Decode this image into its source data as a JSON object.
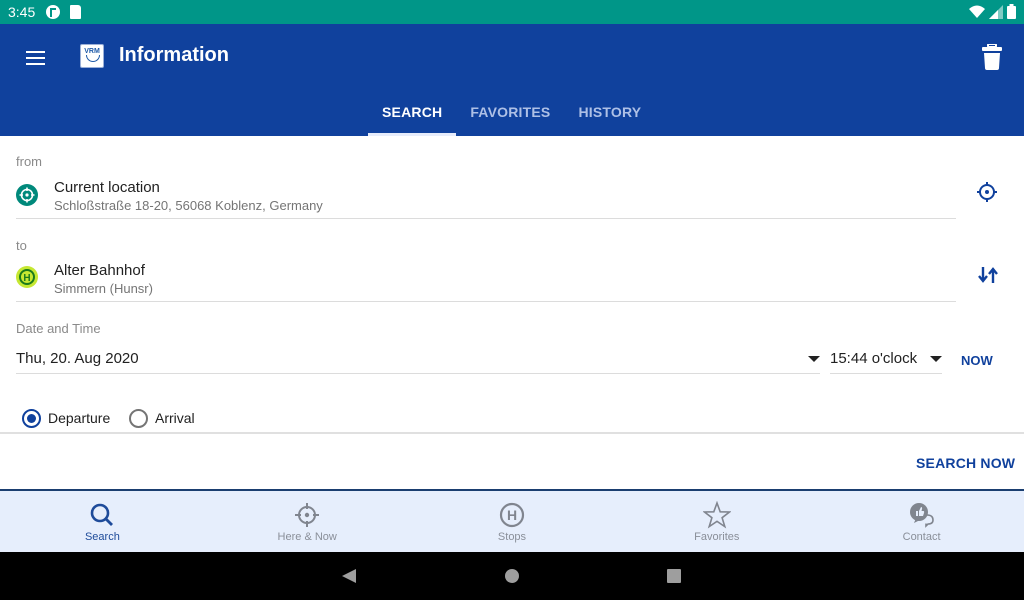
{
  "status_bar": {
    "time": "3:45",
    "left_icons": [
      "notification-app-icon",
      "sd-card-icon"
    ],
    "right_icons": [
      "wifi-icon",
      "signal-icon",
      "battery-icon"
    ]
  },
  "app_bar": {
    "title": "Information",
    "logo_text": "VRM",
    "menu_icon": "menu-icon",
    "action_icon": "trash-icon"
  },
  "tabs": [
    {
      "label": "SEARCH",
      "active": true
    },
    {
      "label": "FAVORITES",
      "active": false
    },
    {
      "label": "HISTORY",
      "active": false
    }
  ],
  "form": {
    "from": {
      "label": "from",
      "title": "Current location",
      "subtitle": "Schloßstraße 18-20, 56068 Koblenz, Germany",
      "icon": "location-target-icon",
      "action_icon": "locate-me-icon"
    },
    "to": {
      "label": "to",
      "title": "Alter Bahnhof",
      "subtitle": "Simmern (Hunsr)",
      "icon": "bus-stop-icon",
      "action_icon": "swap-icon"
    },
    "datetime": {
      "label": "Date and Time",
      "date": "Thu, 20. Aug 2020",
      "time": "15:44 o'clock",
      "now_label": "NOW"
    },
    "mode": {
      "options": [
        {
          "label": "Departure",
          "checked": true
        },
        {
          "label": "Arrival",
          "checked": false
        }
      ]
    },
    "search_label": "SEARCH NOW"
  },
  "bottom_nav": [
    {
      "label": "Search",
      "icon": "search-icon",
      "active": true
    },
    {
      "label": "Here & Now",
      "icon": "crosshair-icon",
      "active": false
    },
    {
      "label": "Stops",
      "icon": "bus-stop-icon",
      "active": false
    },
    {
      "label": "Favorites",
      "icon": "star-icon",
      "active": false
    },
    {
      "label": "Contact",
      "icon": "chat-like-icon",
      "active": false
    }
  ],
  "colors": {
    "status_bar": "#009688",
    "primary": "#10419d",
    "nav_bg": "#e6eefc",
    "from_icon": "#00897b",
    "to_icon": "#c6e832"
  }
}
